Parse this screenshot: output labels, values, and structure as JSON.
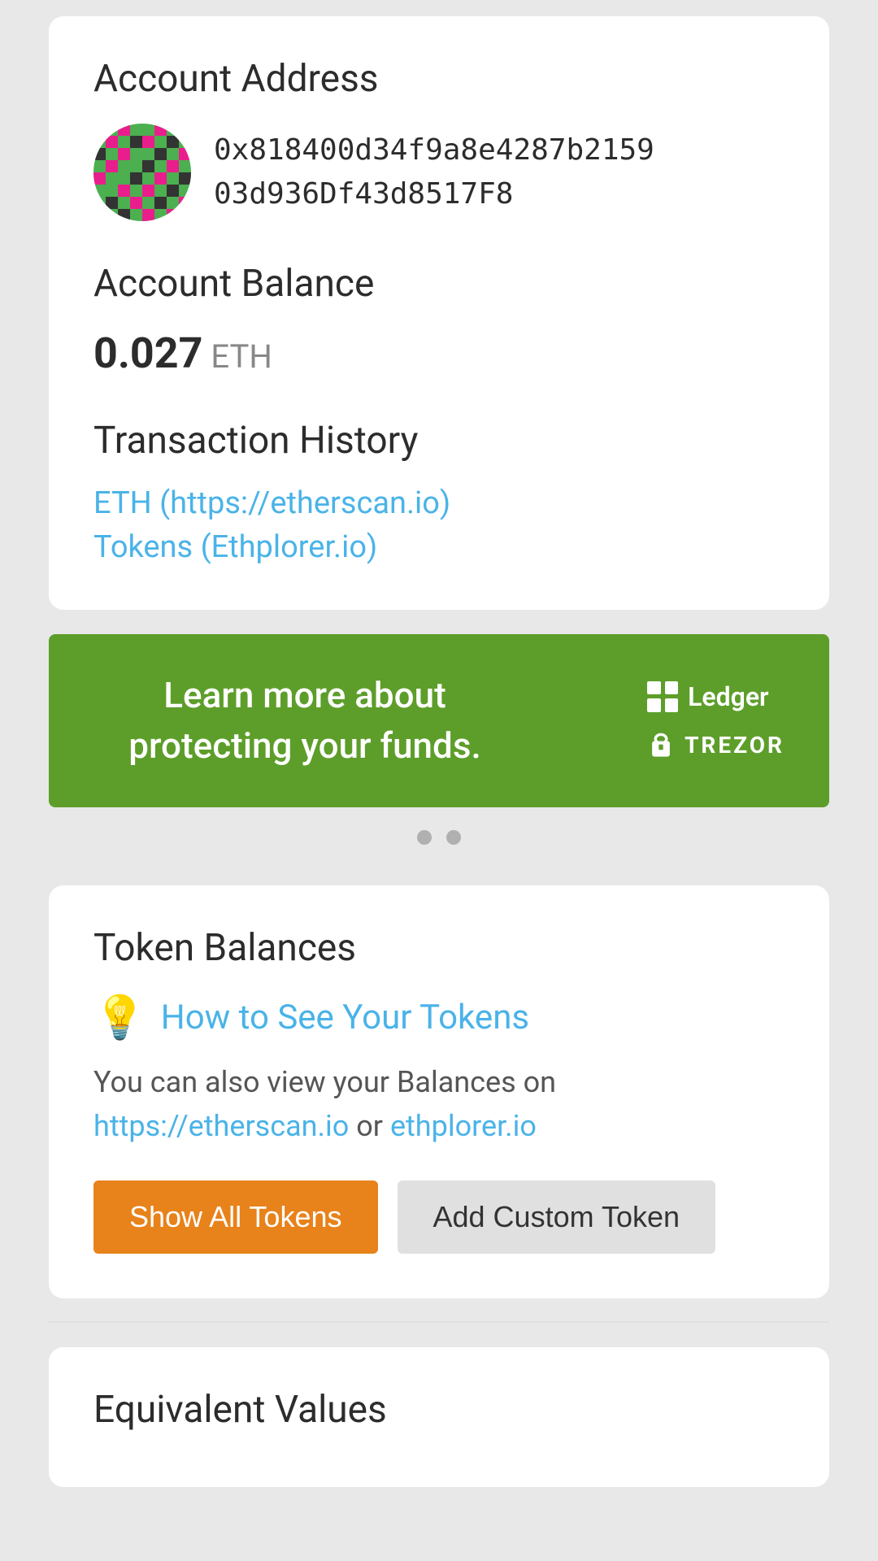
{
  "account": {
    "section_title": "Account Address",
    "address_line1": "0x818400d34f9a8e4287b2159",
    "address_line2": "03d936Df43d8517F8",
    "balance_section": "Account Balance",
    "balance_amount": "0.027",
    "balance_unit": "ETH",
    "tx_section": "Transaction History",
    "tx_link1": "ETH (https://etherscan.io)",
    "tx_link2": "Tokens (Ethplorer.io)"
  },
  "banner": {
    "text": "Learn more about protecting your funds.",
    "ledger_label": "Ledger",
    "trezor_label": "TREZOR"
  },
  "tokens": {
    "section_title": "Token Balances",
    "help_link": "How to See Your Tokens",
    "desc_text": "You can also view your Balances on",
    "desc_or": "or",
    "etherscan_link": "https://etherscan.io",
    "ethplorer_link": "ethplorer.io",
    "btn_show": "Show All Tokens",
    "btn_add": "Add Custom Token"
  },
  "equivalent": {
    "section_title": "Equivalent Values"
  },
  "dots": {
    "dot1_active": false,
    "dot2_active": false
  }
}
